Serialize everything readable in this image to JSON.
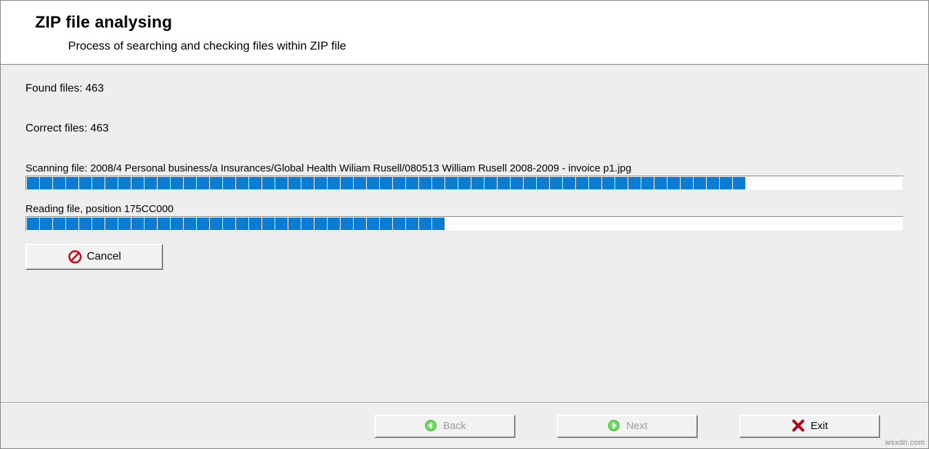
{
  "header": {
    "title": "ZIP file analysing",
    "subtitle": "Process of searching and checking files within ZIP file"
  },
  "stats": {
    "found_label": "Found files: 463",
    "correct_label": "Correct files: 463"
  },
  "scan": {
    "label": "Scanning file: 2008/4 Personal business/a Insurances/Global Health Wiliam Rusell/080513 William Rusell 2008-2009 - invoice p1.jpg",
    "progress_percent": 83
  },
  "read": {
    "label": "Reading file, position 175CC000",
    "progress_percent": 49
  },
  "buttons": {
    "cancel": "Cancel",
    "back": "Back",
    "next": "Next",
    "exit": "Exit"
  },
  "watermark": "wsxdn.com"
}
